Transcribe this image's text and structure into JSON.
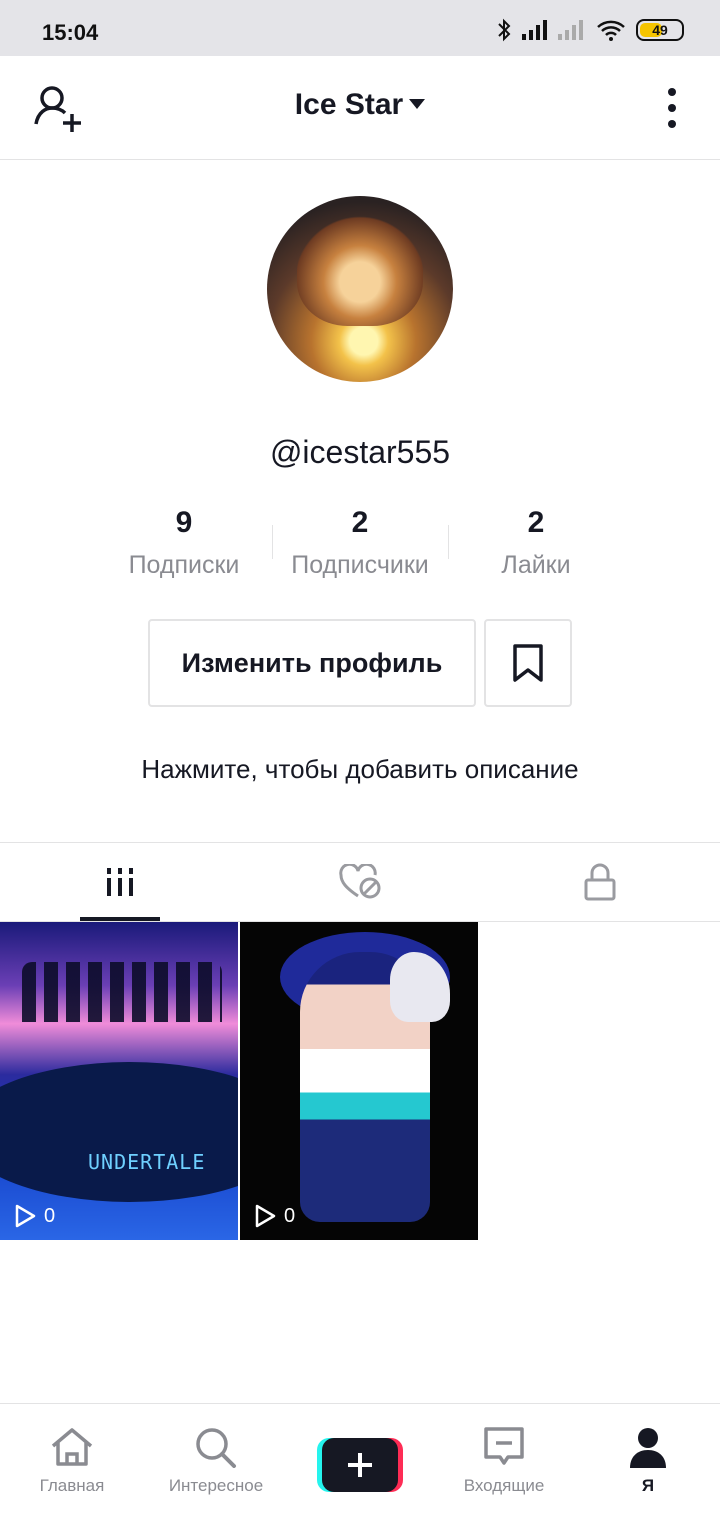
{
  "status_bar": {
    "time": "15:04",
    "battery": "49"
  },
  "header": {
    "title": "Ice Star"
  },
  "profile": {
    "username": "@icestar555",
    "stats": [
      {
        "value": "9",
        "label": "Подписки"
      },
      {
        "value": "2",
        "label": "Подписчики"
      },
      {
        "value": "2",
        "label": "Лайки"
      }
    ],
    "edit_profile_label": "Изменить профиль",
    "bio_placeholder": "Нажмите, чтобы добавить описание"
  },
  "tabs": [
    {
      "icon": "video-grid-icon",
      "active": true
    },
    {
      "icon": "liked-hidden-icon",
      "active": false
    },
    {
      "icon": "lock-icon",
      "active": false
    }
  ],
  "videos": [
    {
      "caption_art": "UNDERTALE",
      "views": "0"
    },
    {
      "views": "0"
    }
  ],
  "bottom_nav": [
    {
      "label": "Главная",
      "icon": "home-icon"
    },
    {
      "label": "Интересное",
      "icon": "search-icon"
    },
    {
      "label": "",
      "icon": "plus-icon"
    },
    {
      "label": "Входящие",
      "icon": "inbox-icon"
    },
    {
      "label": "Я",
      "icon": "profile-icon",
      "active": true
    }
  ],
  "colors": {
    "accent_pink": "#fe2c55",
    "accent_cyan": "#25f4ee",
    "text": "#161823",
    "muted": "#8a8b91"
  }
}
